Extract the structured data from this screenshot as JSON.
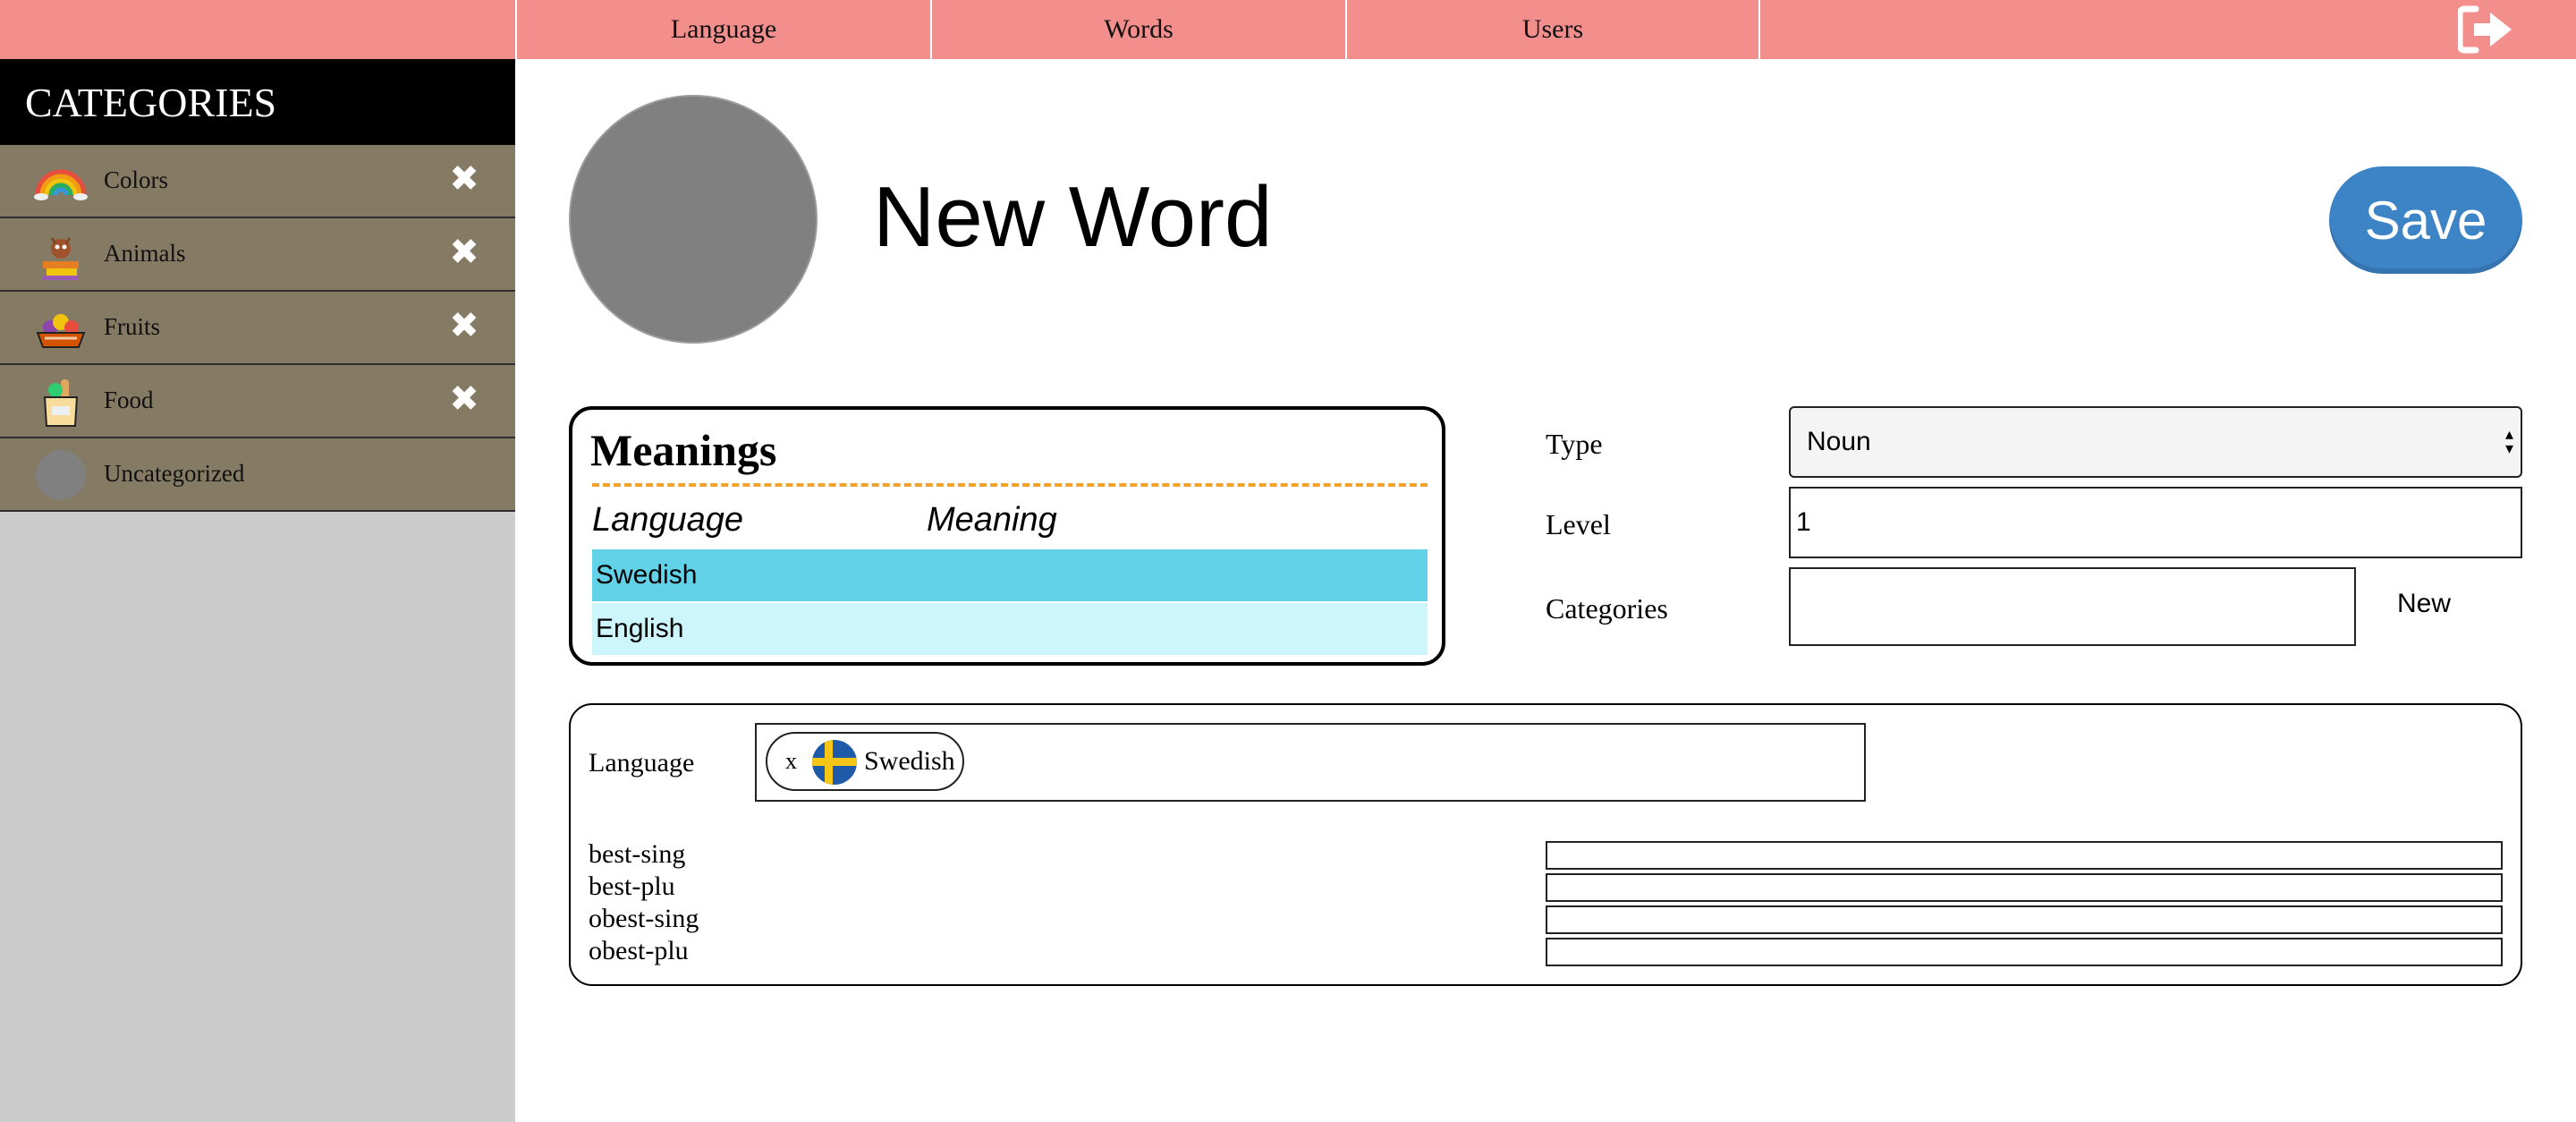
{
  "nav": {
    "tabs": [
      "Language",
      "Words",
      "Users"
    ],
    "logout_icon": "sign-out-icon"
  },
  "sidebar": {
    "title": "CATEGORIES",
    "items": [
      {
        "label": "Colors",
        "icon": "rainbow-icon",
        "removable": true
      },
      {
        "label": "Animals",
        "icon": "animals-icon",
        "removable": true
      },
      {
        "label": "Fruits",
        "icon": "fruit-basket-icon",
        "removable": true
      },
      {
        "label": "Food",
        "icon": "grocery-bag-icon",
        "removable": true
      },
      {
        "label": "Uncategorized",
        "icon": "grey-circle-icon",
        "removable": false
      }
    ],
    "remove_glyph": "✖"
  },
  "word": {
    "title": "New Word",
    "save_label": "Save"
  },
  "meanings": {
    "title": "Meanings",
    "headers": [
      "Language",
      "Meaning"
    ],
    "rows": [
      {
        "language": "Swedish",
        "meaning": "",
        "color": "#62d2e9"
      },
      {
        "language": "English",
        "meaning": "",
        "color": "#cdf6fc"
      }
    ]
  },
  "form": {
    "type_label": "Type",
    "type_value": "Noun",
    "level_label": "Level",
    "level_value": "1",
    "categories_label": "Categories",
    "categories_value": "",
    "new_label": "New"
  },
  "inflections": {
    "language_label": "Language",
    "selected_language": {
      "remove": "x",
      "name": "Swedish",
      "flag_icon": "sweden-flag-icon"
    },
    "fields": [
      {
        "label": "best-sing",
        "value": ""
      },
      {
        "label": "best-plu",
        "value": ""
      },
      {
        "label": "obest-sing",
        "value": ""
      },
      {
        "label": "obest-plu",
        "value": ""
      }
    ]
  },
  "colors": {
    "nav_bg": "#f28e8c",
    "category_bg": "#857a63",
    "save_bg": "#3d84c6",
    "dash": "#f0a22c"
  }
}
